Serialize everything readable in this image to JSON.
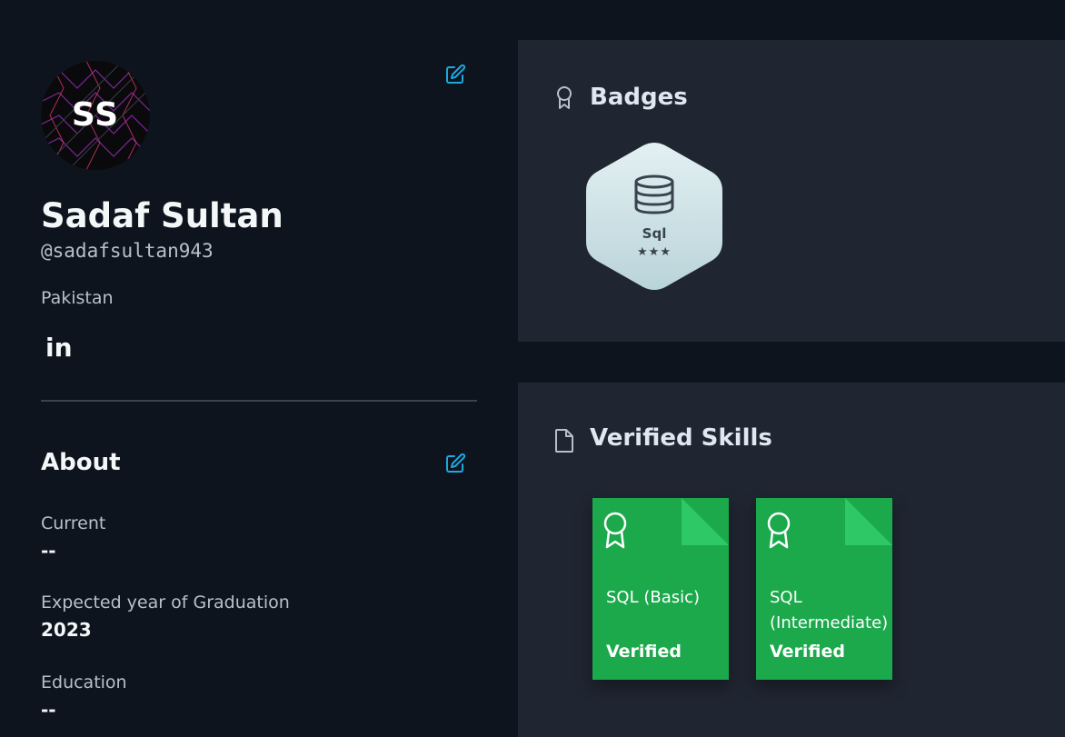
{
  "profile": {
    "initials": "SS",
    "name": "Sadaf Sultan",
    "handle": "@sadafsultan943",
    "country": "Pakistan",
    "social": {
      "linkedin_label": "in"
    }
  },
  "about": {
    "title": "About",
    "fields": [
      {
        "label": "Current",
        "value": "--"
      },
      {
        "label": "Expected year of Graduation",
        "value": "2023"
      },
      {
        "label": "Education",
        "value": "--"
      }
    ]
  },
  "badges": {
    "title": "Badges",
    "items": [
      {
        "name": "Sql",
        "stars": "★★★",
        "star_count": 3
      }
    ]
  },
  "skills": {
    "title": "Verified Skills",
    "items": [
      {
        "name": "SQL (Basic)",
        "status": "Verified"
      },
      {
        "name": "SQL (Intermediate)",
        "status": "Verified"
      }
    ]
  },
  "icons": {
    "edit": "edit-icon",
    "badge_section": "ribbon-icon",
    "skills_section": "document-icon",
    "badge_item": "database-icon",
    "skill_item": "award-icon"
  },
  "colors": {
    "page_bg": "#0e141e",
    "card_bg": "#1f2531",
    "accent_edit": "#1ba9e1",
    "skill_green": "#1ba94c",
    "skill_fold": "#2ec866",
    "text_primary": "#f3f7f7",
    "text_secondary": "#b7c0c9"
  }
}
